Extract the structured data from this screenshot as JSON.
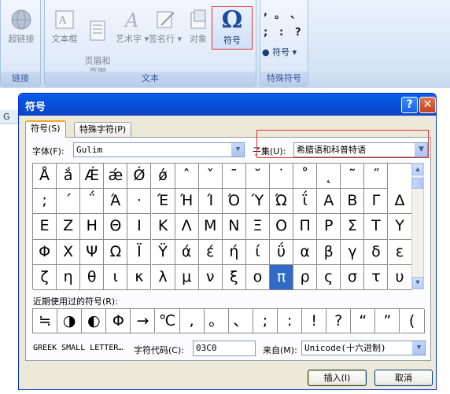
{
  "ribbon": {
    "groups": {
      "links": {
        "label": "链接",
        "buttons": [
          {
            "label": "超链接"
          }
        ]
      },
      "text": {
        "label": "文本",
        "buttons": [
          {
            "label": "文本框"
          },
          {
            "label": "页眉和\n页脚"
          },
          {
            "label": "艺术字"
          },
          {
            "label": "签名行"
          },
          {
            "label": "对象"
          },
          {
            "label": "符号"
          }
        ]
      },
      "special": {
        "label": "特殊符号",
        "symbols": [
          ",",
          "。",
          "、",
          ";",
          ":",
          "?"
        ],
        "symbol_button": "符号"
      }
    },
    "symbol_glyph": "Ω",
    "dropdown_glyph": "▾"
  },
  "sheet": {
    "column_label": "G"
  },
  "dialog": {
    "title": "符号",
    "help_glyph": "?",
    "close_glyph": "✕",
    "tabs": [
      {
        "label": "符号(S)"
      },
      {
        "label": "特殊字符(P)"
      }
    ],
    "font": {
      "label": "字体(F):",
      "value": "Gulim"
    },
    "subset": {
      "label": "子集(U):",
      "value": "希腊语和科普特语"
    },
    "grid": [
      [
        "Å",
        "ắ",
        "Ǽ",
        "ǽ",
        "Ǿ",
        "ǿ",
        "ˆ",
        "ˇ",
        "ˉ",
        "˘",
        "˙",
        "˚",
        "˛",
        "˜",
        "˝"
      ],
      [
        ";",
        "΄",
        "΅",
        "Ά",
        "·",
        "Έ",
        "Ή",
        "Ί",
        "Ό",
        "Ύ",
        "Ώ",
        "ΐ",
        "Α",
        "Β",
        "Γ",
        "Δ"
      ],
      [
        "Ε",
        "Ζ",
        "Η",
        "Θ",
        "Ι",
        "Κ",
        "Λ",
        "Μ",
        "Ν",
        "Ξ",
        "Ο",
        "Π",
        "Ρ",
        "Σ",
        "Τ",
        "Υ"
      ],
      [
        "Φ",
        "Χ",
        "Ψ",
        "Ω",
        "Ϊ",
        "Ϋ",
        "ά",
        "έ",
        "ή",
        "ί",
        "ΰ",
        "α",
        "β",
        "γ",
        "δ",
        "ε"
      ],
      [
        "ζ",
        "η",
        "θ",
        "ι",
        "κ",
        "λ",
        "μ",
        "ν",
        "ξ",
        "ο",
        "π",
        "ρ",
        "ς",
        "σ",
        "τ",
        "υ"
      ]
    ],
    "selected": {
      "row": 4,
      "col": 10
    },
    "scroll_up_glyph": "▲",
    "scroll_down_glyph": "▼",
    "recent": {
      "label": "近期使用过的符号(R):",
      "symbols": [
        "≒",
        "◑",
        "◐",
        "Φ",
        "→",
        "℃",
        ",",
        "。",
        "、",
        ";",
        ":",
        "!",
        "?",
        "“",
        "”",
        "("
      ]
    },
    "char_name": "GREEK SMALL LETTER…",
    "char_code": {
      "label": "字符代码(C):",
      "value": "03C0"
    },
    "from": {
      "label": "来自(M):",
      "value": "Unicode(十六进制)"
    },
    "buttons": {
      "insert": "插入(I)",
      "cancel": "取消"
    }
  }
}
